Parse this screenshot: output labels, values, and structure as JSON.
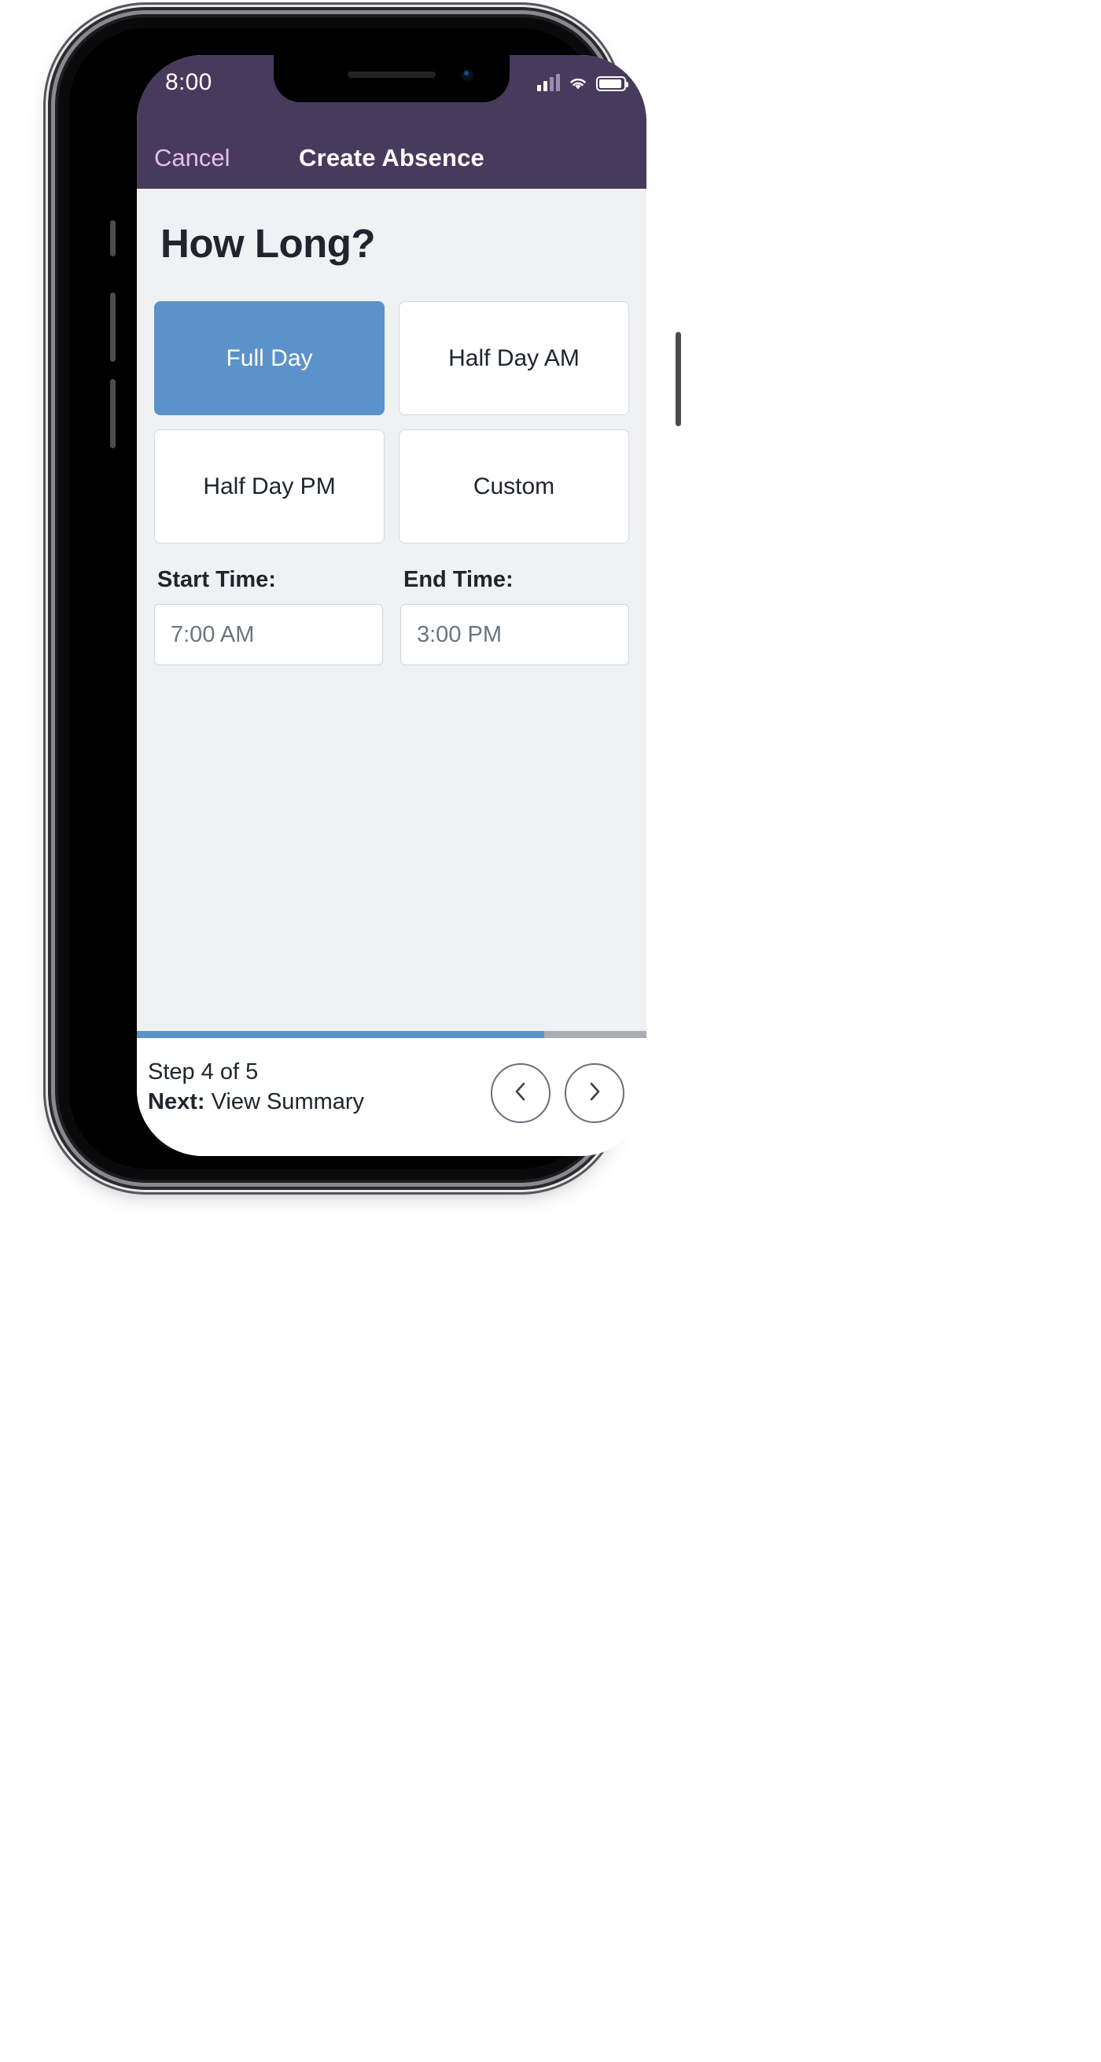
{
  "status_bar": {
    "time": "8:00",
    "icons": [
      "cellular-signal-icon",
      "wifi-icon",
      "battery-icon"
    ]
  },
  "nav": {
    "cancel_label": "Cancel",
    "title": "Create Absence"
  },
  "page": {
    "title": "How Long?"
  },
  "duration_options": [
    {
      "label": "Full Day",
      "selected": true
    },
    {
      "label": "Half Day AM",
      "selected": false
    },
    {
      "label": "Half Day PM",
      "selected": false
    },
    {
      "label": "Custom",
      "selected": false
    }
  ],
  "time_fields": {
    "start": {
      "label": "Start Time:",
      "value": "7:00 AM"
    },
    "end": {
      "label": "End Time:",
      "value": "3:00 PM"
    }
  },
  "footer": {
    "step_text": "Step 4 of 5",
    "next_prefix": "Next:",
    "next_label": "View Summary",
    "progress_percent": 80,
    "prev_icon": "chevron-left-icon",
    "next_icon": "chevron-right-icon"
  },
  "colors": {
    "header_purple": "#483a5c",
    "accent_blue": "#5b92c9",
    "cancel_pink": "#e7bdf0",
    "body_bg": "#eff1f3",
    "text_dark": "#20242d",
    "muted_text": "#6c757d",
    "progress_track": "#a9adb2"
  }
}
